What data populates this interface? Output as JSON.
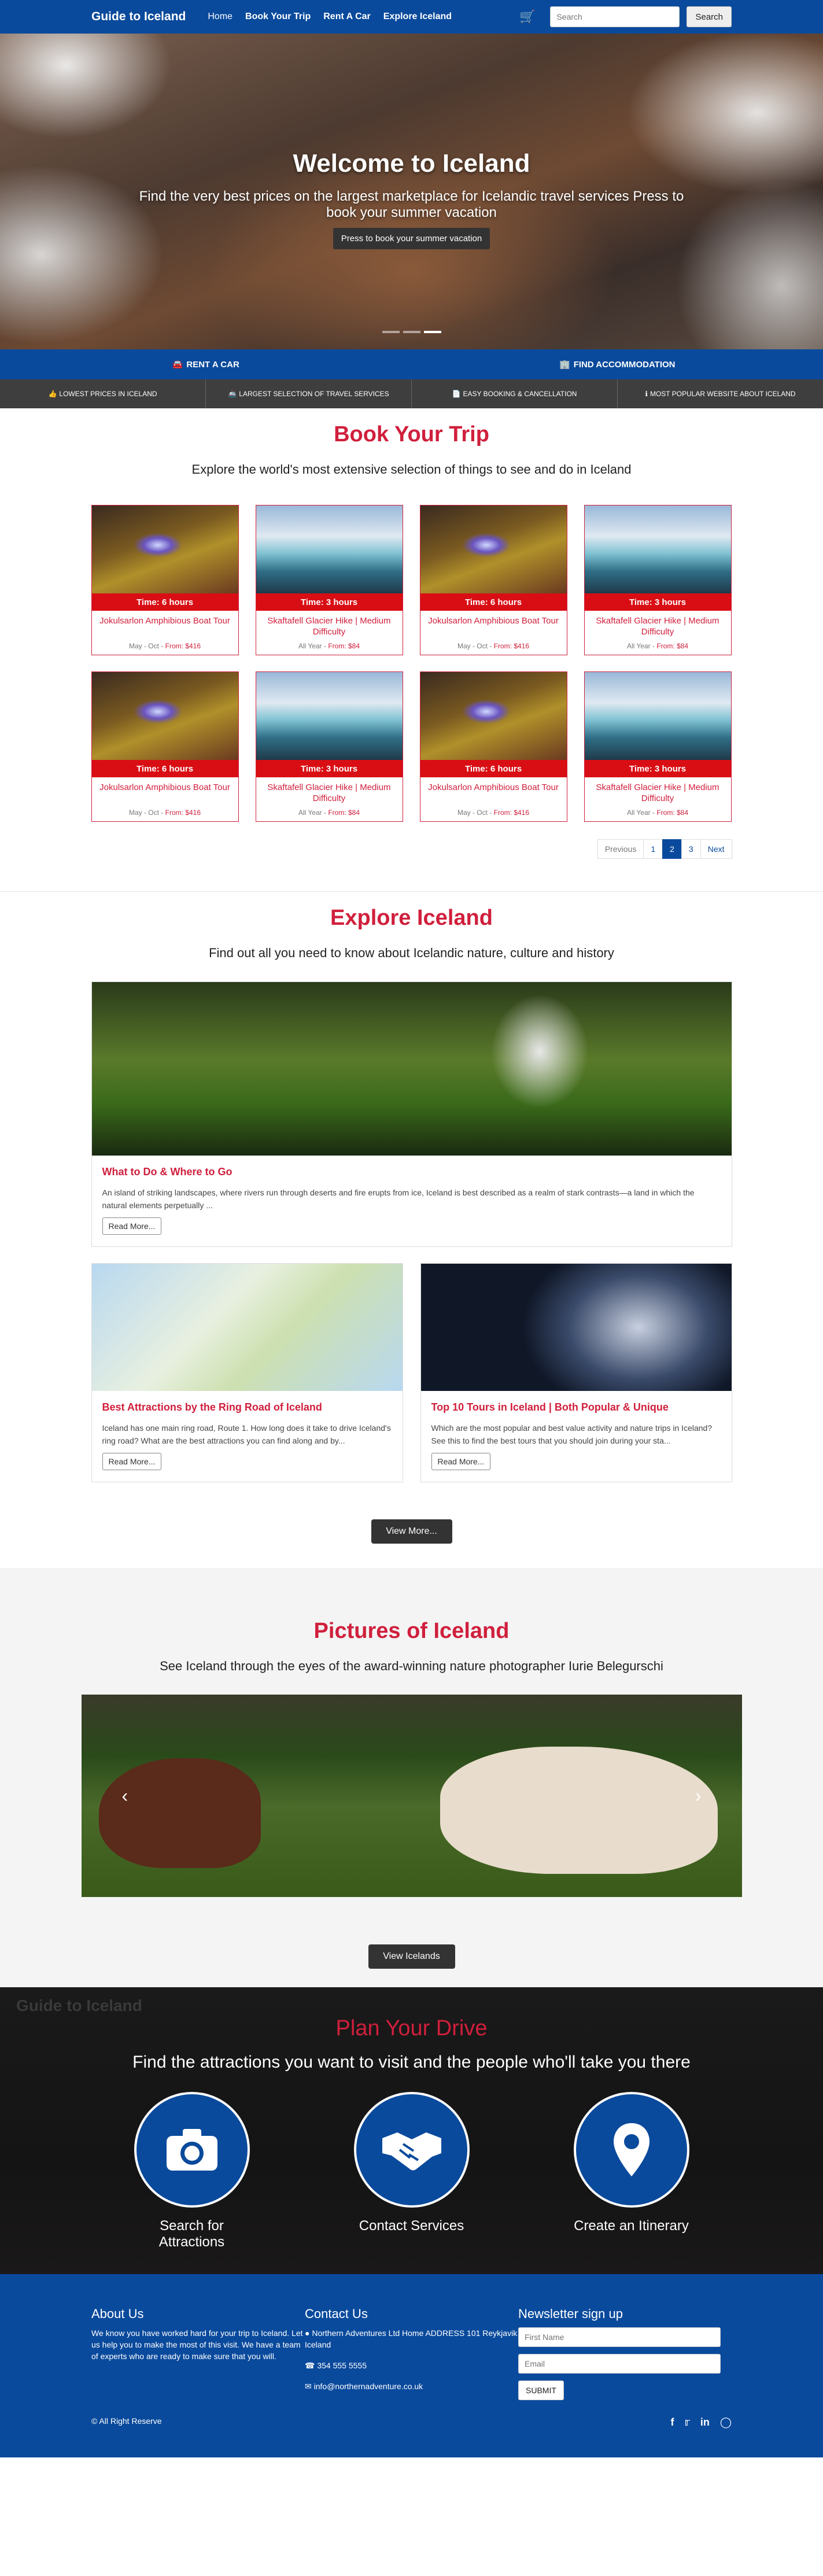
{
  "nav": {
    "brand": "Guide to Iceland",
    "links": [
      "Home",
      "Book Your Trip",
      "Rent A Car",
      "Explore Iceland"
    ],
    "search_placeholder": "Search",
    "search_button": "Search"
  },
  "hero": {
    "title": "Welcome to Iceland",
    "subtitle": "Find the very best prices on the largest marketplace for Icelandic travel services Press to book your summer vacation",
    "button": "Press to book your summer vacation"
  },
  "action_bar": {
    "rent": "RENT A CAR",
    "accommodation": "FIND ACCOMMODATION"
  },
  "features": [
    "LOWEST PRICES IN ICELAND",
    "LARGEST SELECTION OF TRAVEL SERVICES",
    "EASY BOOKING & CANCELLATION",
    "MOST POPULAR WEBSITE ABOUT ICELAND"
  ],
  "book": {
    "title": "Book Your Trip",
    "subtitle": "Explore the world's most extensive selection of things to see and do in Iceland",
    "tours": [
      {
        "time": "Time: 6 hours",
        "name": "Jokulsarlon Amphibious Boat Tour",
        "season": "May - Oct",
        "price": "From: $416"
      },
      {
        "time": "Time: 3 hours",
        "name": "Skaftafell Glacier Hike | Medium Difficulty",
        "season": "All Year",
        "price": "From: $84"
      },
      {
        "time": "Time: 6 hours",
        "name": "Jokulsarlon Amphibious Boat Tour",
        "season": "May - Oct",
        "price": "From: $416"
      },
      {
        "time": "Time: 3 hours",
        "name": "Skaftafell Glacier Hike | Medium Difficulty",
        "season": "All Year",
        "price": "From: $84"
      },
      {
        "time": "Time: 6 hours",
        "name": "Jokulsarlon Amphibious Boat Tour",
        "season": "May - Oct",
        "price": "From: $416"
      },
      {
        "time": "Time: 3 hours",
        "name": "Skaftafell Glacier Hike | Medium Difficulty",
        "season": "All Year",
        "price": "From: $84"
      },
      {
        "time": "Time: 6 hours",
        "name": "Jokulsarlon Amphibious Boat Tour",
        "season": "May - Oct",
        "price": "From: $416"
      },
      {
        "time": "Time: 3 hours",
        "name": "Skaftafell Glacier Hike | Medium Difficulty",
        "season": "All Year",
        "price": "From: $84"
      }
    ],
    "pager": {
      "prev": "Previous",
      "pages": [
        "1",
        "2",
        "3"
      ],
      "next": "Next"
    }
  },
  "explore": {
    "title": "Explore Iceland",
    "subtitle": "Find out all you need to know about Icelandic nature, culture and history",
    "main": {
      "title": "What to Do & Where to Go",
      "text": "An island of striking landscapes, where rivers run through deserts and fire erupts from ice, Iceland is best described as a realm of stark contrasts—a land in which the natural elements perpetually ...",
      "button": "Read More..."
    },
    "left": {
      "title": "Best Attractions by the Ring Road of Iceland",
      "text": "Iceland has one main ring road, Route 1. How long does it take to drive Iceland's ring road? What are the best attractions you can find along and by...",
      "button": "Read More..."
    },
    "right": {
      "title": "Top 10 Tours in Iceland | Both Popular & Unique",
      "text": "Which are the most popular and best value activity and nature trips in Iceland? See this to find the best tours that you should join during your sta...",
      "button": "Read More..."
    },
    "view_more": "View More..."
  },
  "pictures": {
    "title": "Pictures of Iceland",
    "subtitle": "See Iceland through the eyes of the award-winning nature photographer Iurie Belegurschi",
    "button": "View Icelands"
  },
  "plan": {
    "logo": "Guide to Iceland",
    "title": "Plan Your Drive",
    "subtitle": "Find the attractions you want to visit and the people who'll take you there",
    "items": [
      "Search for Attractions",
      "Contact Services",
      "Create an Itinerary"
    ]
  },
  "footer": {
    "about_title": "About Us",
    "about_text": "We know you have worked hard for your trip to Iceland. Let us help you to make the most of this visit. We have a team of experts who are ready to make sure that you will.",
    "contact_title": "Contact Us",
    "address": "Northern Adventures Ltd Home ADDRESS 101 Reykjavik Iceland",
    "phone": "354 555 5555",
    "email": "info@northernadventure.co.uk",
    "newsletter_title": "Newsletter sign up",
    "first_name_placeholder": "First Name",
    "email_placeholder": "Email",
    "submit": "SUBMIT",
    "copyright": "© All Right Reserve"
  },
  "colors": {
    "brand_blue": "#0a4a9c",
    "accent_red": "#d01f3c",
    "time_red": "#d90e14"
  }
}
